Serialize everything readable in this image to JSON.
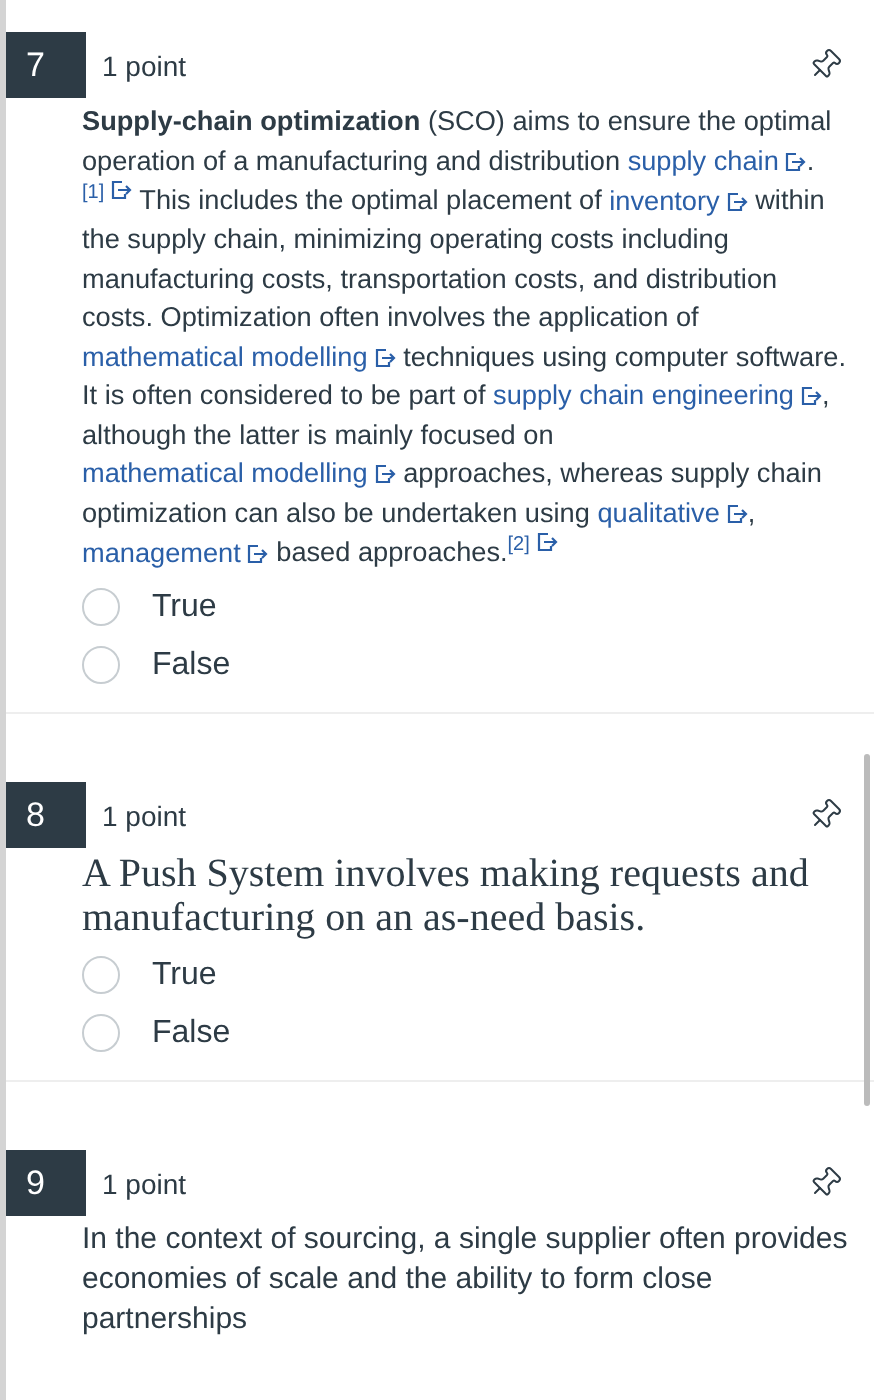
{
  "questions": [
    {
      "number": "7",
      "points": "1 point",
      "kind": "sans",
      "body": [
        {
          "kind": "bold",
          "text": "Supply-chain optimization"
        },
        {
          "kind": "text",
          "text": " (SCO) aims to ensure the optimal operation of a manufacturing and distribution "
        },
        {
          "kind": "link",
          "text": "supply chain"
        },
        {
          "kind": "text",
          "text": "."
        },
        {
          "kind": "ref",
          "text": "[1]"
        },
        {
          "kind": "text",
          "text": " This includes the optimal placement of "
        },
        {
          "kind": "link",
          "text": "inventory"
        },
        {
          "kind": "text",
          "text": " within the supply chain, minimizing operating costs including manufacturing costs, transportation costs, and distribution costs. Optimization often involves the application of "
        },
        {
          "kind": "link",
          "text": "mathematical modelling"
        },
        {
          "kind": "text",
          "text": " techniques using computer software. It is often considered to be part of "
        },
        {
          "kind": "link",
          "text": "supply chain engineering"
        },
        {
          "kind": "text",
          "text": ", although the latter is mainly focused on "
        },
        {
          "kind": "link",
          "text": "mathematical modelling"
        },
        {
          "kind": "text",
          "text": " approaches, whereas supply chain optimization can also be undertaken using "
        },
        {
          "kind": "link",
          "text": "qualitative"
        },
        {
          "kind": "text",
          "text": ", "
        },
        {
          "kind": "link",
          "text": "management"
        },
        {
          "kind": "text",
          "text": " based approaches."
        },
        {
          "kind": "ref",
          "text": "[2]"
        }
      ],
      "options": [
        {
          "label": "True",
          "selected": false
        },
        {
          "label": "False",
          "selected": false
        }
      ]
    },
    {
      "number": "8",
      "points": "1 point",
      "kind": "serif",
      "body": [
        {
          "kind": "text",
          "text": "A Push System involves making requests and manufacturing on an as-need basis."
        }
      ],
      "options": [
        {
          "label": "True",
          "selected": false
        },
        {
          "label": "False",
          "selected": false
        }
      ]
    },
    {
      "number": "9",
      "points": "1 point",
      "kind": "sans",
      "body": [
        {
          "kind": "text",
          "text": "In the context of sourcing, a single supplier often provides economies of scale and the ability to form close partnerships"
        }
      ]
    }
  ]
}
